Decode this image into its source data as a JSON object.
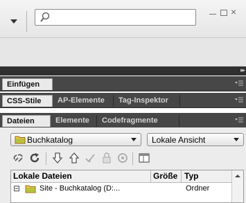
{
  "search": {
    "placeholder": "",
    "value": ""
  },
  "window_controls": {
    "minimize": "–",
    "maximize": "□",
    "close": "×"
  },
  "panels": [
    {
      "tabs": [
        "Einfügen"
      ]
    },
    {
      "tabs": [
        "CSS-Stile",
        "AP-Elemente",
        "Tag-Inspektor"
      ]
    },
    {
      "tabs": [
        "Dateien",
        "Elemente",
        "Codefragmente"
      ]
    }
  ],
  "files": {
    "site_select": "Buchkatalog",
    "view_select": "Lokale Ansicht",
    "toolbar_icons": [
      "connect-icon",
      "refresh-icon",
      "get-files-icon",
      "put-files-icon",
      "checkout-icon",
      "checkin-icon",
      "sync-icon",
      "expand-icon"
    ],
    "columns": [
      "Lokale Dateien",
      "Größe",
      "Typ"
    ],
    "rows": [
      {
        "expander": "⊟",
        "name": "Site - Buchkatalog (D:...",
        "size": "",
        "type": "Ordner"
      }
    ]
  },
  "colors": {
    "panel_header": "#474747",
    "dark_strip": "#303030",
    "folder": "#f5c542"
  }
}
